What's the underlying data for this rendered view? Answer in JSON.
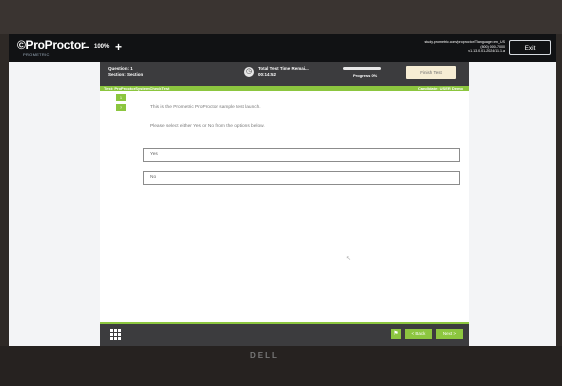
{
  "app": {
    "logo_text": "ProProctor",
    "logo_subtext": "PROMETRIC",
    "zoom": {
      "minus": "−",
      "value": "100%",
      "plus": "+"
    },
    "info_line1": "study.prometric.com/proproctor/Tlanguage=en_US",
    "info_line2": "(800) 000-7000",
    "info_line3": "v1.13.0.01-2024/11.1.a",
    "exit_label": "Exit"
  },
  "header": {
    "question_label": "Question: 1",
    "section_label": "Section: Section",
    "timer_label": "Total Test Time Remai...",
    "timer_value": "00:14:52",
    "progress_label": "Progress 0%",
    "progress_percent": 0,
    "finish_label": "Finish Test"
  },
  "subheader": {
    "test_name": "Test: ProProctorSystemCheckTest",
    "candidate": "Candidate: USER Demo"
  },
  "qnav": [
    "1",
    "?"
  ],
  "content": {
    "question": "This is the Prometric ProProctor sample test launch.",
    "instruction": "Please select either Yes or No from the options below.",
    "options": [
      "Yes",
      "No"
    ]
  },
  "footer": {
    "flag_icon": "flag-icon",
    "back_label": "< Back",
    "next_label": "Next >"
  },
  "bezel": {
    "brand": "DELL"
  },
  "colors": {
    "accent": "#8cc63f",
    "header": "#3c3c3e",
    "appbar": "#111214"
  }
}
